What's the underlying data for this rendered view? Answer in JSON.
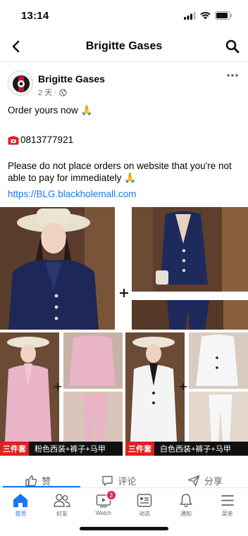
{
  "status": {
    "time": "13:14",
    "icons": [
      "signal-icon",
      "wifi-icon",
      "battery-icon"
    ]
  },
  "header": {
    "title": "Brigitte Gases",
    "back_icon": "chevron-left-icon",
    "search_icon": "search-icon"
  },
  "post": {
    "page_name": "Brigitte Gases",
    "time": "2 天",
    "privacy_icon": "globe-icon",
    "more_icon": "more-dots-icon",
    "line1": "Order yours now 🙏",
    "phone": "0813777921",
    "line3": "Please do not place orders on website that you're not able to pay for immediately 🙏",
    "link": "https://BLG.blackholemall.com"
  },
  "photos": {
    "captions": [
      {
        "tag": "三件套",
        "text": "粉色西装+裤子+马甲"
      },
      {
        "tag": "三件套",
        "text": "白色西装+裤子+马甲"
      }
    ]
  },
  "actions": [
    {
      "label": "赞",
      "icon": "thumbs-up-icon"
    },
    {
      "label": "评论",
      "icon": "comment-icon"
    },
    {
      "label": "分享",
      "icon": "share-icon"
    }
  ],
  "tabs": [
    {
      "label": "首页",
      "icon": "home-icon",
      "active": true
    },
    {
      "label": "好友",
      "icon": "friends-icon"
    },
    {
      "label": "Watch",
      "icon": "watch-icon",
      "badge": "3"
    },
    {
      "label": "动态",
      "icon": "feed-icon"
    },
    {
      "label": "通知",
      "icon": "bell-icon"
    },
    {
      "label": "菜单",
      "icon": "menu-icon"
    }
  ],
  "colors": {
    "accent": "#1877f2",
    "badge": "#e41e3f",
    "caption_tag": "#e02020"
  }
}
